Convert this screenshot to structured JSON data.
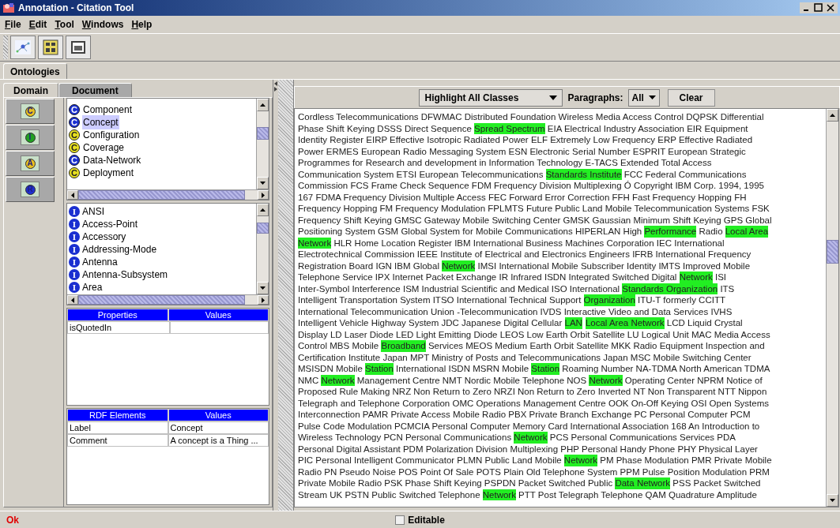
{
  "window": {
    "title": "Annotation - Citation Tool"
  },
  "menu": [
    "File",
    "Edit",
    "Tool",
    "Windows",
    "Help"
  ],
  "main_tabs": [
    {
      "label": "Ontologies",
      "selected": true
    }
  ],
  "left_tabs": [
    {
      "label": "Domain",
      "selected": true
    },
    {
      "label": "Document",
      "selected": false
    }
  ],
  "type_buttons": [
    {
      "symbol": "C",
      "color": "#e8c020"
    },
    {
      "symbol": "I",
      "color": "#20a020"
    },
    {
      "symbol": "A",
      "color": "#e8c020"
    },
    {
      "symbol": "R",
      "color": "#2030d0"
    }
  ],
  "classes": [
    {
      "label": "Component",
      "symbol": "C",
      "color": "#1a2fd0",
      "selected": false
    },
    {
      "label": "Concept",
      "symbol": "C",
      "color": "#1a2fd0",
      "selected": true
    },
    {
      "label": "Configuration",
      "symbol": "C",
      "color": "#e8e020",
      "selected": false
    },
    {
      "label": "Coverage",
      "symbol": "C",
      "color": "#e8e020",
      "selected": false
    },
    {
      "label": "Data-Network",
      "symbol": "C",
      "color": "#1a2fd0",
      "selected": false
    },
    {
      "label": "Deployment",
      "symbol": "C",
      "color": "#e8e020",
      "selected": false
    }
  ],
  "instances": [
    {
      "label": "ANSI",
      "symbol": "I"
    },
    {
      "label": "Access-Point",
      "symbol": "I"
    },
    {
      "label": "Accessory",
      "symbol": "I"
    },
    {
      "label": "Addressing-Mode",
      "symbol": "I"
    },
    {
      "label": "Antenna",
      "symbol": "I"
    },
    {
      "label": "Antenna-Subsystem",
      "symbol": "I"
    },
    {
      "label": "Area",
      "symbol": "I"
    }
  ],
  "properties": {
    "columns": [
      "Properties",
      "Values"
    ],
    "rows": [
      [
        "isQuotedIn",
        ""
      ]
    ]
  },
  "rdf": {
    "columns": [
      "RDF Elements",
      "Values"
    ],
    "rows": [
      [
        "Label",
        "Concept"
      ],
      [
        "Comment",
        "A concept is a Thing ..."
      ]
    ]
  },
  "highlight_select": {
    "value": "Highlight All Classes"
  },
  "paragraphs": {
    "label": "Paragraphs:",
    "value": "All"
  },
  "clear_button": "Clear",
  "lines": [
    [
      {
        "text": "Cordless Telecommunications DFWMAC Distributed Foundation Wireless Media Access Control DQPSK Differential",
        "highlighted": false
      }
    ],
    [
      {
        "text": "Phase Shift Keying DSSS Direct Sequence ",
        "highlighted": false
      },
      {
        "text": "Spread Spectrum",
        "highlighted": true
      },
      {
        "text": " EIA Electrical Industry Association EIR Equipment",
        "highlighted": false
      }
    ],
    [
      {
        "text": "Identity Register EIRP Effective Isotropic Radiated Power ELF Extremely Low Frequency ERP Effective Radiated",
        "highlighted": false
      }
    ],
    [
      {
        "text": "Power ERMES European Radio Messaging System ESN Electronic Serial Number ESPRIT European Strategic",
        "highlighted": false
      }
    ],
    [
      {
        "text": "Programmes for Research and development in Information Technology E-TACS Extended Total Access",
        "highlighted": false
      }
    ],
    [
      {
        "text": "Communication System ETSI European Telecommunications ",
        "highlighted": false
      },
      {
        "text": "Standards Institute",
        "highlighted": true
      },
      {
        "text": " FCC Federal Communications",
        "highlighted": false
      }
    ],
    [
      {
        "text": "Commission FCS Frame Check Sequence FDM Frequency Division Multiplexing Ó Copyright IBM Corp. 1994, 1995",
        "highlighted": false
      }
    ],
    [
      {
        "text": "167 FDMA Frequency Division Multiple Access FEC Forward Error Correction FFH Fast Frequency Hopping FH",
        "highlighted": false
      }
    ],
    [
      {
        "text": "Frequency Hopping FM Frequency Modulation FPLMTS Future Public Land Mobile Telecommunication Systems FSK",
        "highlighted": false
      }
    ],
    [
      {
        "text": "Frequency Shift Keying GMSC Gateway Mobile Switching Center GMSK Gaussian Minimum Shift Keying GPS Global",
        "highlighted": false
      }
    ],
    [
      {
        "text": "Positioning System GSM Global System for Mobile Communications HIPERLAN High ",
        "highlighted": false
      },
      {
        "text": "Performance",
        "highlighted": true
      },
      {
        "text": " Radio ",
        "highlighted": false
      },
      {
        "text": "Local Area",
        "highlighted": true
      }
    ],
    [
      {
        "text": "Network",
        "highlighted": true
      },
      {
        "text": " HLR Home Location Register IBM International Business Machines Corporation IEC International",
        "highlighted": false
      }
    ],
    [
      {
        "text": "Electrotechnical Commission IEEE Institute of Electrical and Electronics Engineers IFRB International Frequency",
        "highlighted": false
      }
    ],
    [
      {
        "text": "Registration Board IGN IBM Global ",
        "highlighted": false
      },
      {
        "text": "Network",
        "highlighted": true
      },
      {
        "text": " IMSI International Mobile Subscriber Identity IMTS Improved Mobile",
        "highlighted": false
      }
    ],
    [
      {
        "text": "Telephone Service IPX Internet Packet Exchange IR Infrared ISDN Integrated Switched Digital ",
        "highlighted": false
      },
      {
        "text": "Network",
        "highlighted": true
      },
      {
        "text": " ISI",
        "highlighted": false
      }
    ],
    [
      {
        "text": "Inter-Symbol Interference ISM Industrial Scientific and Medical ISO International ",
        "highlighted": false
      },
      {
        "text": "Standards Organization",
        "highlighted": true
      },
      {
        "text": " ITS",
        "highlighted": false
      }
    ],
    [
      {
        "text": "Intelligent Transportation System ITSO International Technical Support ",
        "highlighted": false
      },
      {
        "text": "Organization",
        "highlighted": true
      },
      {
        "text": " ITU-T formerly CCITT",
        "highlighted": false
      }
    ],
    [
      {
        "text": "International Telecommunication Union -Telecommunication IVDS Interactive Video and Data Services IVHS",
        "highlighted": false
      }
    ],
    [
      {
        "text": "Intelligent Vehicle Highway System JDC Japanese Digital Cellular ",
        "highlighted": false
      },
      {
        "text": "LAN",
        "highlighted": true
      },
      {
        "text": "Local Area Network",
        "highlighted": true
      },
      {
        "text": " LCD Liquid Crystal",
        "highlighted": false
      }
    ],
    [
      {
        "text": "Display LD Laser Diode LED Light Emitting Diode LEOS Low Earth Orbit Satellite LU Logical Unit MAC Media Access",
        "highlighted": false
      }
    ],
    [
      {
        "text": "Control MBS Mobile ",
        "highlighted": false
      },
      {
        "text": "Broadband",
        "highlighted": true
      },
      {
        "text": " Services MEOS Medium Earth Orbit Satellite MKK Radio Equipment Inspection and",
        "highlighted": false
      }
    ],
    [
      {
        "text": "Certification Institute Japan MPT Ministry of Posts and Telecommunications Japan MSC Mobile Switching Center",
        "highlighted": false
      }
    ],
    [
      {
        "text": "MSISDN Mobile ",
        "highlighted": false
      },
      {
        "text": "Station",
        "highlighted": true
      },
      {
        "text": " International ISDN MSRN Mobile ",
        "highlighted": false
      },
      {
        "text": "Station",
        "highlighted": true
      },
      {
        "text": " Roaming Number NA-TDMA North American TDMA",
        "highlighted": false
      }
    ],
    [
      {
        "text": "NMC ",
        "highlighted": false
      },
      {
        "text": "Network",
        "highlighted": true
      },
      {
        "text": " Management Centre NMT Nordic Mobile Telephone NOS ",
        "highlighted": false
      },
      {
        "text": "Network",
        "highlighted": true
      },
      {
        "text": " Operating Center NPRM Notice of",
        "highlighted": false
      }
    ],
    [
      {
        "text": "Proposed Rule Making NRZ Non Return to Zero NRZI Non Return to Zero Inverted NT Non Transparent NTT Nippon",
        "highlighted": false
      }
    ],
    [
      {
        "text": "Telegraph and Telephone Corporation OMC Operations Management Centre OOK On-Off Keying OSI Open Systems",
        "highlighted": false
      }
    ],
    [
      {
        "text": "Interconnection PAMR Private Access Mobile Radio PBX Private Branch Exchange PC Personal Computer PCM",
        "highlighted": false
      }
    ],
    [
      {
        "text": "Pulse Code Modulation PCMCIA Personal Computer Memory Card International Association 168 An Introduction to",
        "highlighted": false
      }
    ],
    [
      {
        "text": "Wireless Technology PCN Personal Communications ",
        "highlighted": false
      },
      {
        "text": "Network",
        "highlighted": true
      },
      {
        "text": " PCS Personal Communications Services PDA",
        "highlighted": false
      }
    ],
    [
      {
        "text": "Personal Digital Assistant PDM Polarization Division Multiplexing PHP Personal Handy Phone PHY Physical Layer",
        "highlighted": false
      }
    ],
    [
      {
        "text": "PIC Personal Intelligent Communicator PLMN Public Land Mobile ",
        "highlighted": false
      },
      {
        "text": "Network",
        "highlighted": true
      },
      {
        "text": " PM Phase Modulation PMR Private Mobile",
        "highlighted": false
      }
    ],
    [
      {
        "text": "Radio PN Pseudo Noise POS Point Of Sale POTS Plain Old Telephone System PPM Pulse Position Modulation PRM",
        "highlighted": false
      }
    ],
    [
      {
        "text": "Private Mobile Radio PSK Phase Shift Keying PSPDN Packet Switched Public ",
        "highlighted": false
      },
      {
        "text": "Data Network",
        "highlighted": true
      },
      {
        "text": " PSS Packet Switched",
        "highlighted": false
      }
    ],
    [
      {
        "text": "Stream UK PSTN Public Switched Telephone ",
        "highlighted": false
      },
      {
        "text": "Network",
        "highlighted": true
      },
      {
        "text": " PTT Post Telegraph Telephone QAM Quadrature Amplitude",
        "highlighted": false
      }
    ]
  ],
  "status": {
    "message": "Ok"
  },
  "editable": {
    "label": "Editable",
    "checked": false
  }
}
